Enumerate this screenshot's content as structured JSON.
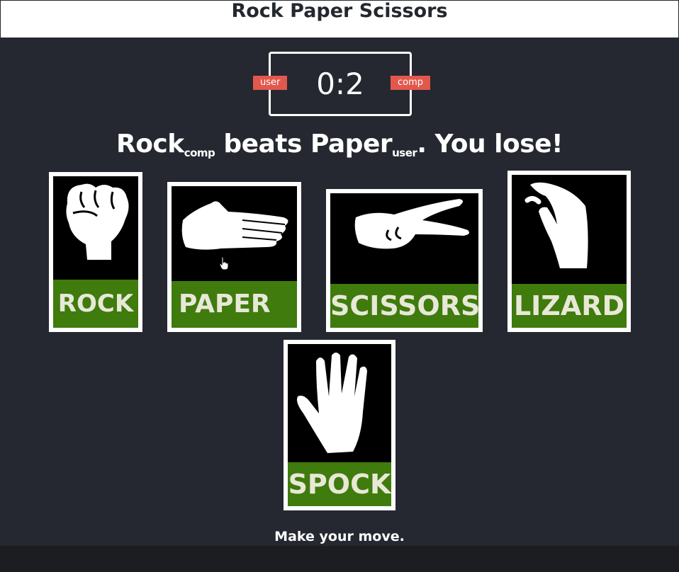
{
  "header": {
    "title": "Rock Paper Scissors"
  },
  "score": {
    "display": "0:2",
    "user_label": "user",
    "comp_label": "comp"
  },
  "result": {
    "comp_move": "Rock",
    "comp_tag": "comp",
    "verb": " beats ",
    "user_move": "Paper",
    "user_tag": "user",
    "outcome": ". You lose!"
  },
  "choices": [
    {
      "label": "ROCK",
      "icon": "fist-icon"
    },
    {
      "label": "PAPER",
      "icon": "open-hand-icon"
    },
    {
      "label": "SCISSORS",
      "icon": "scissors-hand-icon"
    },
    {
      "label": "LIZARD",
      "icon": "lizard-hand-icon"
    },
    {
      "label": "SPOCK",
      "icon": "vulcan-salute-icon"
    }
  ],
  "prompt": "Make your move.",
  "colors": {
    "background": "#252830",
    "badge": "#e2584d",
    "label_bg": "#3f7b0d",
    "header_bg": "#ffffff"
  }
}
